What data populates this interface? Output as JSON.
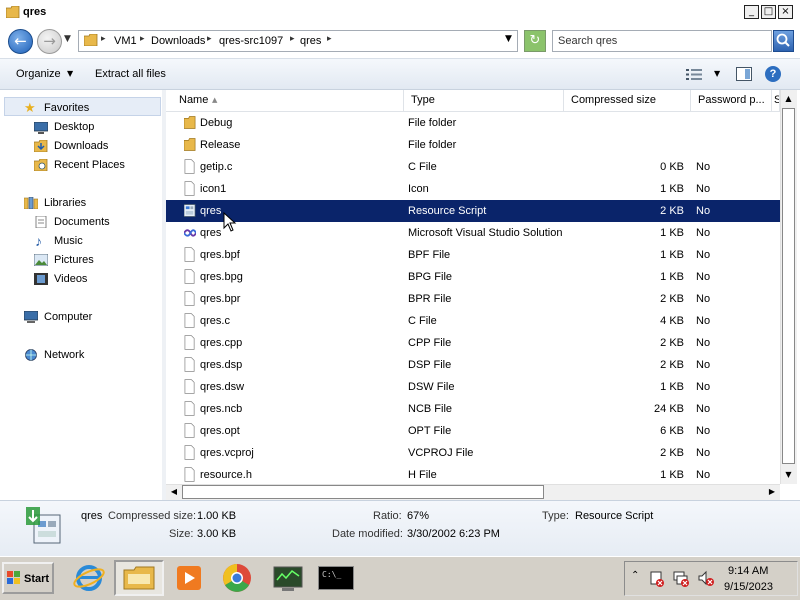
{
  "window": {
    "title": "qres",
    "minimize": "_",
    "maximize": "□",
    "close": "×"
  },
  "address": {
    "crumbs": [
      "VM1",
      "Downloads",
      "qres-src1097",
      "qres"
    ],
    "separator": "▸"
  },
  "search": {
    "placeholder": "Search qres"
  },
  "toolbar": {
    "organize": "Organize",
    "extract": "Extract all files"
  },
  "nav": {
    "favorites": {
      "header": "Favorites",
      "items": [
        "Desktop",
        "Downloads",
        "Recent Places"
      ]
    },
    "libraries": {
      "header": "Libraries",
      "items": [
        "Documents",
        "Music",
        "Pictures",
        "Videos"
      ]
    },
    "computer": "Computer",
    "network": "Network"
  },
  "columns": [
    "Name",
    "Type",
    "Compressed size",
    "Password p...",
    "S"
  ],
  "files": [
    {
      "name": "Debug",
      "type": "File folder",
      "size": "",
      "pw": "",
      "icon": "folder"
    },
    {
      "name": "Release",
      "type": "File folder",
      "size": "",
      "pw": "",
      "icon": "folder"
    },
    {
      "name": "getip.c",
      "type": "C File",
      "size": "0 KB",
      "pw": "No",
      "icon": "file"
    },
    {
      "name": "icon1",
      "type": "Icon",
      "size": "1 KB",
      "pw": "No",
      "icon": "file"
    },
    {
      "name": "qres",
      "type": "Resource Script",
      "size": "2 KB",
      "pw": "No",
      "icon": "rc"
    },
    {
      "name": "qres",
      "type": "Microsoft Visual Studio Solution",
      "size": "1 KB",
      "pw": "No",
      "icon": "sln"
    },
    {
      "name": "qres.bpf",
      "type": "BPF File",
      "size": "1 KB",
      "pw": "No",
      "icon": "file"
    },
    {
      "name": "qres.bpg",
      "type": "BPG File",
      "size": "1 KB",
      "pw": "No",
      "icon": "file"
    },
    {
      "name": "qres.bpr",
      "type": "BPR File",
      "size": "2 KB",
      "pw": "No",
      "icon": "file"
    },
    {
      "name": "qres.c",
      "type": "C File",
      "size": "4 KB",
      "pw": "No",
      "icon": "file"
    },
    {
      "name": "qres.cpp",
      "type": "CPP File",
      "size": "2 KB",
      "pw": "No",
      "icon": "file"
    },
    {
      "name": "qres.dsp",
      "type": "DSP File",
      "size": "2 KB",
      "pw": "No",
      "icon": "file"
    },
    {
      "name": "qres.dsw",
      "type": "DSW File",
      "size": "1 KB",
      "pw": "No",
      "icon": "file"
    },
    {
      "name": "qres.ncb",
      "type": "NCB File",
      "size": "24 KB",
      "pw": "No",
      "icon": "file"
    },
    {
      "name": "qres.opt",
      "type": "OPT File",
      "size": "6 KB",
      "pw": "No",
      "icon": "file"
    },
    {
      "name": "qres.vcproj",
      "type": "VCPROJ File",
      "size": "2 KB",
      "pw": "No",
      "icon": "file"
    },
    {
      "name": "resource.h",
      "type": "H File",
      "size": "1 KB",
      "pw": "No",
      "icon": "file"
    }
  ],
  "selected_index": 4,
  "details": {
    "name": "qres",
    "compressed_label": "Compressed size:",
    "compressed_value": "1.00 KB",
    "size_label": "Size:",
    "size_value": "3.00 KB",
    "ratio_label": "Ratio:",
    "ratio_value": "67%",
    "modified_label": "Date modified:",
    "modified_value": "3/30/2002 6:23 PM",
    "type_label": "Type:",
    "type_value": "Resource Script"
  },
  "taskbar": {
    "start": "Start",
    "cmd_text": "C:\\_",
    "clock_time": "9:14 AM",
    "clock_date": "9/15/2023"
  },
  "colors": {
    "selection": "#0a246a",
    "folder": "#e8b84a",
    "accent": "#2d6ec0"
  }
}
